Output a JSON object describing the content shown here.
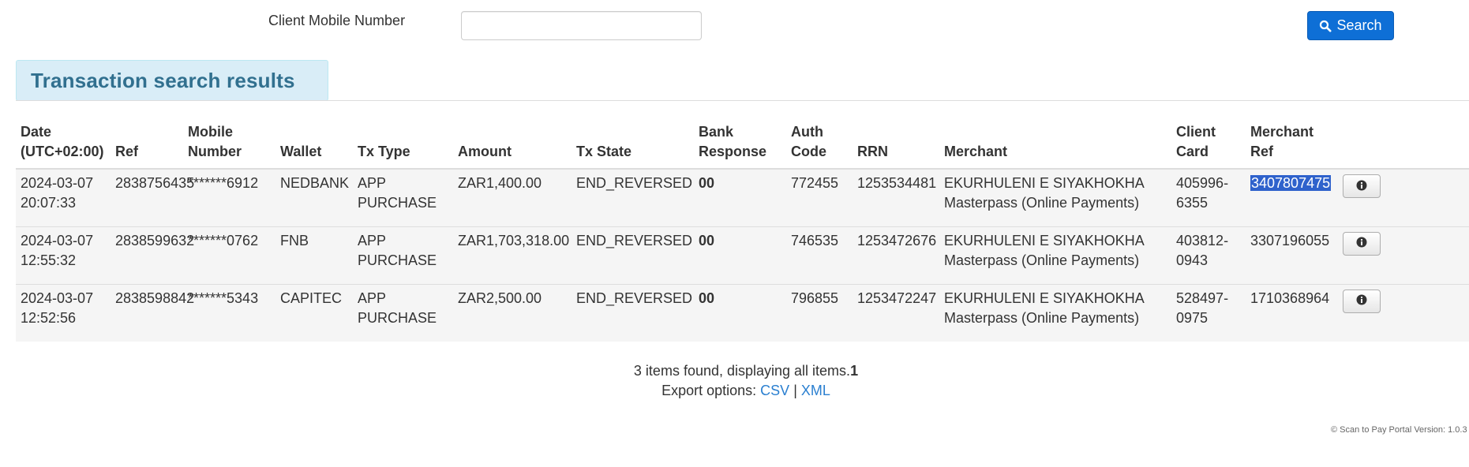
{
  "search": {
    "label": "Client Mobile Number",
    "value": "",
    "placeholder": "",
    "button_label": "Search"
  },
  "results": {
    "title": "Transaction search results",
    "columns": [
      [
        "Date",
        "(UTC+02:00)"
      ],
      [
        "Ref"
      ],
      [
        "Mobile",
        "Number"
      ],
      [
        "Wallet"
      ],
      [
        "Tx Type"
      ],
      [
        "Amount"
      ],
      [
        "Tx State"
      ],
      [
        "Bank",
        "Response"
      ],
      [
        "Auth",
        "Code"
      ],
      [
        "RRN"
      ],
      [
        "Merchant"
      ],
      [
        "Client",
        "Card"
      ],
      [
        "Merchant",
        "Ref"
      ]
    ],
    "rows": [
      {
        "date": [
          "2024-03-07",
          "20:07:33"
        ],
        "ref": "2838756435",
        "mobile": "*******6912",
        "wallet": "NEDBANK",
        "tx_type": [
          "APP",
          "PURCHASE"
        ],
        "amount": "ZAR1,400.00",
        "tx_state": "END_REVERSED",
        "bank_response": "00",
        "auth_code": "772455",
        "rrn": "1253534481",
        "merchant": [
          "EKURHULENI E SIYAKHOKHA",
          "Masterpass (Online Payments)"
        ],
        "client_card": [
          "405996-",
          "6355"
        ],
        "merchant_ref": "3407807475",
        "merchant_ref_selected": true
      },
      {
        "date": [
          "2024-03-07",
          "12:55:32"
        ],
        "ref": "2838599632",
        "mobile": "*******0762",
        "wallet": "FNB",
        "tx_type": [
          "APP",
          "PURCHASE"
        ],
        "amount": "ZAR1,703,318.00",
        "tx_state": "END_REVERSED",
        "bank_response": "00",
        "auth_code": "746535",
        "rrn": "1253472676",
        "merchant": [
          "EKURHULENI E SIYAKHOKHA",
          "Masterpass (Online Payments)"
        ],
        "client_card": [
          "403812-",
          "0943"
        ],
        "merchant_ref": "3307196055",
        "merchant_ref_selected": false
      },
      {
        "date": [
          "2024-03-07",
          "12:52:56"
        ],
        "ref": "2838598842",
        "mobile": "*******5343",
        "wallet": "CAPITEC",
        "tx_type": [
          "APP",
          "PURCHASE"
        ],
        "amount": "ZAR2,500.00",
        "tx_state": "END_REVERSED",
        "bank_response": "00",
        "auth_code": "796855",
        "rrn": "1253472247",
        "merchant": [
          "EKURHULENI E SIYAKHOKHA",
          "Masterpass (Online Payments)"
        ],
        "client_card": [
          "528497-",
          "0975"
        ],
        "merchant_ref": "1710368964",
        "merchant_ref_selected": false
      }
    ],
    "row_action_icon": "info-icon"
  },
  "footer": {
    "summary_text": "3 items found, displaying all items.",
    "page_number": "1",
    "export_label": "Export options:",
    "export_csv": "CSV",
    "export_separator": "|",
    "export_xml": "XML",
    "version": "© Scan to Pay Portal Version: 1.0.3"
  },
  "colors": {
    "primary_button": "#0e6fd6",
    "header_panel_bg": "#d9edf7",
    "header_panel_text": "#31708f",
    "bank_response_ok": "#2a8a2a",
    "link": "#2a7fd0",
    "selection": "#2f62cc",
    "row_bg": "#f5f5f5"
  },
  "icons": {
    "search_button": "search-icon",
    "row_action": "info-icon"
  }
}
